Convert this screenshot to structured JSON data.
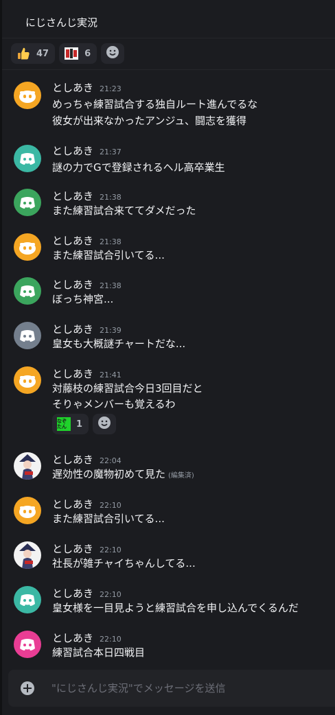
{
  "channel": {
    "title": "にじさんじ実況"
  },
  "top_reactions": [
    {
      "emoji": "thumbs-up-icon",
      "count": "47"
    },
    {
      "emoji": "custom-emote-icon",
      "count": "6"
    }
  ],
  "avatar_colors": {
    "orange": "#f5a623",
    "teal": "#3bb8a4",
    "green": "#3ba55d",
    "grey": "#747f8d",
    "pink": "#e93d94"
  },
  "messages": [
    {
      "author": "としあき",
      "time": "21:23",
      "avatar": "orange",
      "lines": [
        "めっちゃ練習試合する独自ルート進んでるな",
        "彼女が出来なかったアンジュ、闘志を獲得"
      ]
    },
    {
      "author": "としあき",
      "time": "21:37",
      "avatar": "teal",
      "lines": [
        "謎の力でGで登録されるヘル高卒業生"
      ]
    },
    {
      "author": "としあき",
      "time": "21:38",
      "avatar": "green",
      "lines": [
        "また練習試合来ててダメだった"
      ]
    },
    {
      "author": "としあき",
      "time": "21:38",
      "avatar": "orange",
      "lines": [
        "また練習試合引いてる..."
      ]
    },
    {
      "author": "としあき",
      "time": "21:38",
      "avatar": "green",
      "lines": [
        "ぼっち神宮..."
      ]
    },
    {
      "author": "としあき",
      "time": "21:39",
      "avatar": "grey",
      "lines": [
        "皇女も大概謎チャートだな..."
      ]
    },
    {
      "author": "としあき",
      "time": "21:41",
      "avatar": "orange",
      "lines": [
        "対藤枝の練習試合今日3回目だと",
        "そりゃメンバーも覚えるわ"
      ],
      "reaction": {
        "emoji": "なぞたん",
        "count": "1"
      }
    },
    {
      "author": "としあき",
      "time": "22:04",
      "avatar": "image",
      "lines": [
        "遅効性の魔物初めて見た"
      ],
      "edited": "(編集済)"
    },
    {
      "author": "としあき",
      "time": "22:10",
      "avatar": "orange",
      "lines": [
        "また練習試合引いてる..."
      ]
    },
    {
      "author": "としあき",
      "time": "22:10",
      "avatar": "image",
      "lines": [
        "社長が雑チャイちゃんしてる..."
      ]
    },
    {
      "author": "としあき",
      "time": "22:10",
      "avatar": "teal",
      "lines": [
        "皇女様を一目見ようと練習試合を申し込んでくるんだ"
      ]
    },
    {
      "author": "としあき",
      "time": "22:10",
      "avatar": "pink",
      "lines": [
        "練習試合本日四戦目"
      ]
    }
  ],
  "composer": {
    "placeholder": "\"にじさんじ実況\"でメッセージを送信"
  }
}
